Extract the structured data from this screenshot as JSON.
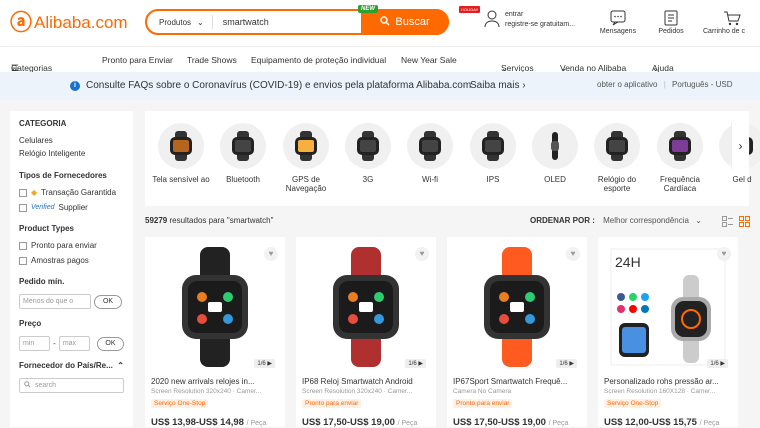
{
  "header": {
    "logo_text": "Alibaba.com",
    "search_category": "Produtos",
    "search_value": "smartwatch",
    "new_badge": "NEW",
    "search_button": "Buscar",
    "user_line1": "entrar",
    "user_line2": "registre-se gratuitam...",
    "messages": "Mensagens",
    "orders": "Pedidos",
    "cart": "Carrinho de c"
  },
  "nav": {
    "categories": "Categorias",
    "items": [
      "Pronto para Enviar",
      "Trade Shows",
      "Equipamento de proteção individual",
      "New Year Sale",
      "Serviços",
      "Venda no Alibaba",
      "Ajuda"
    ],
    "hot_badge": "HOLIDAY"
  },
  "notice": {
    "message": "Consulte FAQs sobre o Coronavírus (COVID-19) e envios pela plataforma Alibaba.com",
    "more": "Saiba mais",
    "app": "obter o aplicativo",
    "lang": "Português - USD"
  },
  "sidebar": {
    "category_title": "CATEGORIA",
    "categories": [
      "Celulares",
      "Relógio Inteligente"
    ],
    "supplier_title": "Tipos de Fornecedores",
    "supplier_options": [
      "Transação Garantida",
      "Supplier"
    ],
    "verified": "Verified",
    "product_title": "Product Types",
    "product_options": [
      "Pronto para enviar",
      "Amostras pagos"
    ],
    "min_order_title": "Pedido mín.",
    "min_order_placeholder": "Menos do que o",
    "ok": "OK",
    "price_title": "Preço",
    "price_min": "min",
    "price_max": "max",
    "country_title": "Fornecedor do País/Re...",
    "search_placeholder": "search"
  },
  "categories_strip": [
    {
      "label": "Tela sensível ao"
    },
    {
      "label": "Bluetooth"
    },
    {
      "label": "GPS de Navegação"
    },
    {
      "label": "3G"
    },
    {
      "label": "Wi-fi"
    },
    {
      "label": "IPS"
    },
    {
      "label": "OLED"
    },
    {
      "label": "Relógio do esporte"
    },
    {
      "label": "Frequência Cardíaca"
    },
    {
      "label": "Gel d"
    }
  ],
  "results": {
    "count": "59279",
    "text": "resultados para \"smartwatch\"",
    "sort_label": "ORDENAR POR :",
    "sort_value": "Melhor correspondência"
  },
  "products": [
    {
      "title": "2020 new arrivals relojes in...",
      "sub": "Screen Resolution 320x240 · Camer...",
      "tag": "Serviço One-Stop",
      "price": "US$ 13,98-US$ 14,98",
      "unit": "/ Peça",
      "pages": "1/6"
    },
    {
      "title": "IP68 Reloj Smartwatch Android",
      "sub": "Screen Resolution 320x240 · Camer...",
      "tag": "Pronto para enviar",
      "price": "US$ 17,50-US$ 19,00",
      "unit": "/ Peça",
      "pages": "1/6"
    },
    {
      "title": "IP67Sport Smartwatch Frequê...",
      "sub": "Camera No Camera",
      "tag": "Pronto para enviar",
      "price": "US$ 17,50-US$ 19,00",
      "unit": "/ Peça",
      "pages": "1/6"
    },
    {
      "title": "Personalizado rohs pressão ar...",
      "sub": "Screen Resolution 160X128 · Camer...",
      "tag": "Serviço One-Stop",
      "price": "US$ 12,00-US$ 15,75",
      "unit": "/ Peça",
      "pages": "1/6"
    }
  ],
  "colors": {
    "accent": "#ff6a00",
    "notice_bg": "#ecf3fb",
    "info": "#1a73c8"
  }
}
